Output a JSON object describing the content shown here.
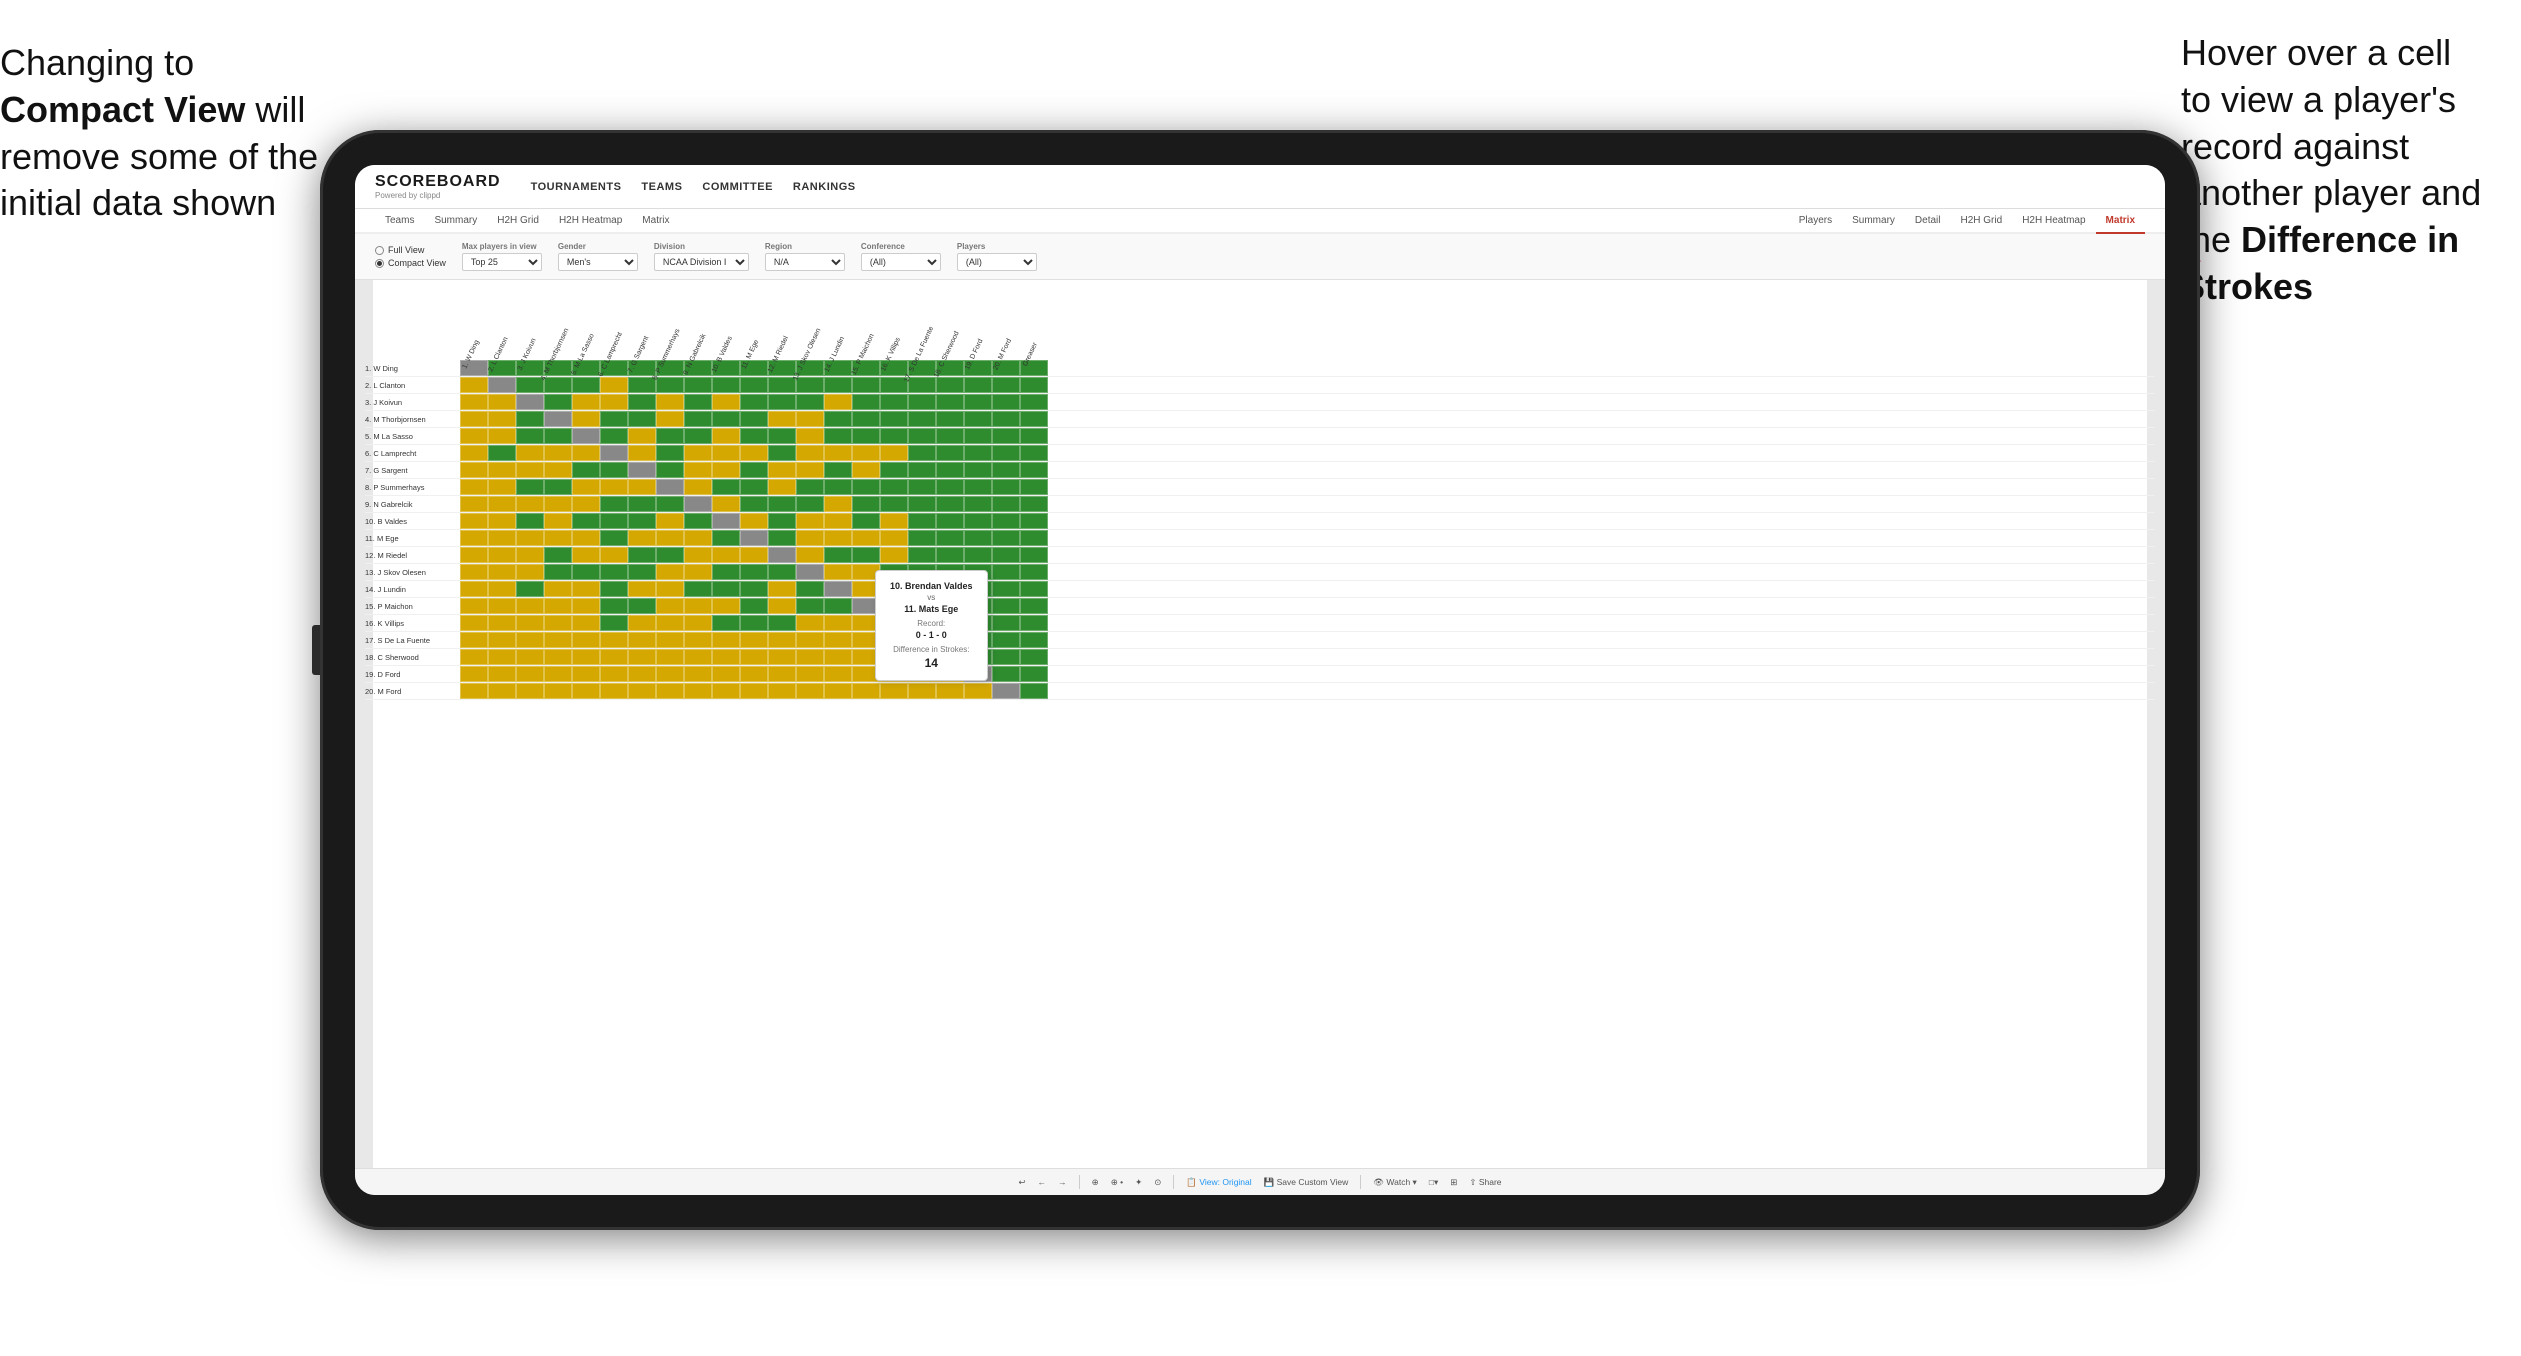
{
  "annotations": {
    "left": {
      "line1": "Changing to",
      "line2bold": "Compact View",
      "line2rest": " will",
      "line3": "remove some of the",
      "line4": "initial data shown"
    },
    "right": {
      "line1": "Hover over a cell",
      "line2": "to view a player's",
      "line3": "record against",
      "line4": "another player and",
      "line5": "the ",
      "line5bold": "Difference in",
      "line6bold": "Strokes"
    }
  },
  "brand": {
    "name": "SCOREBOARD",
    "sub": "Powered by clippd"
  },
  "nav": {
    "links": [
      "TOURNAMENTS",
      "TEAMS",
      "COMMITTEE",
      "RANKINGS"
    ]
  },
  "tabs": {
    "main": [
      "Teams",
      "Summary",
      "H2H Grid",
      "H2H Heatmap",
      "Matrix"
    ],
    "sub": [
      "Players",
      "Summary",
      "Detail",
      "H2H Grid",
      "H2H Heatmap",
      "Matrix"
    ]
  },
  "filters": {
    "view_full": "Full View",
    "view_compact": "Compact View",
    "selected_view": "compact",
    "max_label": "Max players in view",
    "max_value": "Top 25",
    "gender_label": "Gender",
    "gender_value": "Men's",
    "division_label": "Division",
    "division_value": "NCAA Division I",
    "region_label": "Region",
    "region_value": "N/A",
    "conference_label": "Conference",
    "conference_value": "(All)",
    "players_label": "Players",
    "players_value": "(All)"
  },
  "col_headers": [
    "1. W Ding",
    "2. L Clanton",
    "3. J Koivun",
    "4. M Thorbjornsen",
    "5. M La Sasso",
    "6. C Lamprecht",
    "7. G Sargent",
    "8. P Summerhays",
    "9. N Gabrelcik",
    "10. B Valdes",
    "11. M Ege",
    "12. M Riedel",
    "13. J Skov Olesen",
    "14. J Lundin",
    "15. P Maichon",
    "16. K Villips",
    "17. S De La Fuente",
    "18. C Sherwood",
    "19. D Ford",
    "20. M Ford",
    "Greaser"
  ],
  "row_players": [
    "1. W Ding",
    "2. L Clanton",
    "3. J Koivun",
    "4. M Thorbjornsen",
    "5. M La Sasso",
    "6. C Lamprecht",
    "7. G Sargent",
    "8. P Summerhays",
    "9. N Gabrelcik",
    "10. B Valdes",
    "11. M Ege",
    "12. M Riedel",
    "13. J Skov Olesen",
    "14. J Lundin",
    "15. P Maichon",
    "16. K Villips",
    "17. S De La Fuente",
    "18. C Sherwood",
    "19. D Ford",
    "20. M Ford"
  ],
  "tooltip": {
    "player1": "10. Brendan Valdes",
    "vs": "vs",
    "player2": "11. Mats Ege",
    "record_label": "Record:",
    "record": "0 - 1 - 0",
    "diff_label": "Difference in Strokes:",
    "diff": "14"
  },
  "toolbar": {
    "items": [
      "↩",
      "←",
      "→",
      "⊕",
      "⊕ •",
      "✦",
      "⊙",
      "View: Original",
      "Save Custom View",
      "⊙ Watch ▾",
      "□▾",
      "⊞",
      "Share"
    ]
  },
  "colors": {
    "green": "#3a8c3a",
    "yellow": "#d4a800",
    "gray": "#c0c0c0",
    "red_tab": "#c0392b",
    "self": "#999999"
  }
}
